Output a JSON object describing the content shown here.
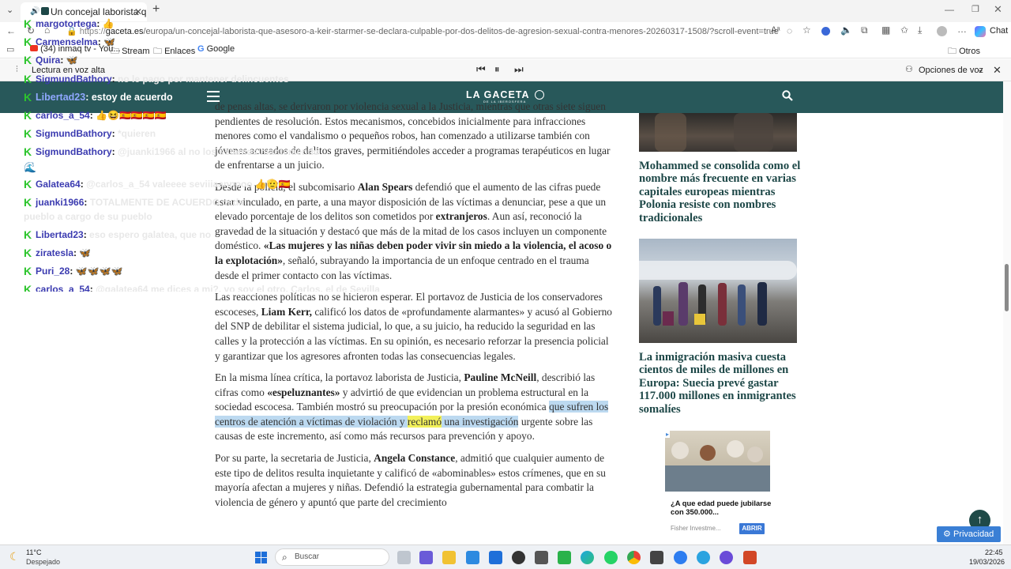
{
  "browser": {
    "tab_title": "Un concejal laborista que ase",
    "url_prefix": "https://",
    "url_domain": "gaceta.es",
    "url_path": "/europa/un-concejal-laborista-que-asesoro-a-keir-starmer-se-declara-culpable-por-dos-delitos-de-agresion-sexual-contra-menores-20260317-1508/?scroll-event=true",
    "chat_label": "Chat",
    "bookmarks": [
      "(34) inmaq tv - You...",
      "Stream",
      "Enlaces",
      "Google"
    ],
    "other_favorites": "Otros favoritos",
    "read_aloud_label": "Lectura en voz alta",
    "voice_options_label": "Opciones de voz"
  },
  "site": {
    "logo_text": "LA GACETA",
    "logo_sub": "DE LA IBEROSFERA"
  },
  "article": {
    "p1_frag": "de penas altas, se derivaron por violencia sexual a la Justicia, mientras que otras siete siguen pendientes de resolución. Estos mecanismos, concebidos inicialmente para infracciones menores como el vandalismo o pequeños robos, han comenzado a utilizarse también con jóvenes acusados de delitos graves, permitiéndoles acceder a programas terapéuticos en lugar de enfrentarse a un juicio.",
    "p2_a": "Desde la policía, el subcomisario ",
    "p2_b": "Alan Spears",
    "p2_c": " defendió que el aumento de las cifras puede estar vinculado, en parte, a una mayor disposición de las víctimas a denunciar, pese a que un elevado porcentaje de los delitos son cometidos por ",
    "p2_d": "extranjeros",
    "p2_e": ". Aun así, reconoció la gravedad de la situación y destacó que más de la mitad de los casos incluyen un componente doméstico. ",
    "p2_f": "«Las mujeres y las niñas deben poder vivir sin miedo a la violencia, el acoso o la explotación»",
    "p2_g": ", señaló, subrayando la importancia de un enfoque centrado en el trauma desde el primer contacto con las víctimas.",
    "p3_a": "Las reacciones políticas no se hicieron esperar. El portavoz de Justicia de los conservadores escoceses, ",
    "p3_b": "Liam Kerr,",
    "p3_c": " calificó los datos de «profundamente alarmantes» y acusó al Gobierno del SNP de debilitar el sistema judicial, lo que, a su juicio, ha reducido la seguridad en las calles y la protección a las víctimas. En su opinión, es necesario reforzar la presencia policial y garantizar que los agresores afronten todas las consecuencias legales.",
    "p4_a": "En la misma línea crítica, la portavoz laborista de Justicia, ",
    "p4_b": "Pauline McNeill",
    "p4_c": ", describió las cifras como ",
    "p4_d": "«espeluznantes»",
    "p4_e": " y advirtió de que evidencian un problema estructural en la sociedad escocesa. También mostró su preocupación por la presión económica ",
    "p4_f": "que sufren los centros de atención a víctimas de violación y ",
    "p4_g": "reclamó",
    "p4_h": " una investigación",
    "p4_i": " urgente sobre las causas de este incremento, así como más recursos para prevención y apoyo.",
    "p5_a": "Por su parte, la secretaria de Justicia, ",
    "p5_b": "Angela Constance",
    "p5_c": ", admitió que cualquier aumento de este tipo de delitos resulta inquietante y calificó de «abominables» estos crímenes, que en su mayoría afectan a mujeres y niñas. Defendió la estrategia gubernamental para combatir la violencia de género y apuntó que parte del crecimiento"
  },
  "sidebar": {
    "story1_title": "Mohammed se consolida como el nombre más frecuente en varias capitales europeas mientras Polonia resiste con nombres tradicionales",
    "story2_title": "La inmigración masiva cuesta cientos de miles de millones en Europa: Suecia prevé gastar 117.000 millones en inmigrantes somalíes",
    "ad_title": "¿A que edad puede jubilarse con 350.000...",
    "ad_sponsor": "Fisher Investme...",
    "ad_button": "ABRIR",
    "privacy_label": "Privacidad"
  },
  "chat": [
    {
      "user": "margotortega",
      "msg": "👍"
    },
    {
      "user": "Carmenselma",
      "msg": "🦋"
    },
    {
      "user": "Quira",
      "msg": "🦋"
    },
    {
      "user": "SigmundBathory",
      "msg": "no le pago por mantener delincuentes"
    },
    {
      "user": "Libertad23",
      "msg": "estoy de acuerdo"
    },
    {
      "user": "carlos_a_54",
      "msg": "👍😆🇪🇸🇪🇸🇪🇸🇪🇸"
    },
    {
      "user": "SigmundBathory",
      "msg": "*quieren"
    },
    {
      "user": "SigmundBathory",
      "msg": "@juanki1966 al no los estamos manteniendo"
    },
    {
      "user": "Galatea64",
      "msg": "@carlos_a_54 valeeee seviiiaannooo 👍🫡🇪🇸"
    },
    {
      "user": "juanki1966",
      "msg": "TOTALMENTE DE ACUERDO cada pueblo a cargo de su pueblo"
    },
    {
      "user": "Libertad23",
      "msg": "eso espero galatea, que no"
    },
    {
      "user": "ziratesla",
      "msg": "🦋"
    },
    {
      "user": "Puri_28",
      "msg": "🦋🦋🦋🦋"
    },
    {
      "user": "carlos_a_54",
      "msg": "@galatea64 me dices a mi?, yo soy el otro, Carlos, el de Sevilla"
    }
  ],
  "taskbar": {
    "temp": "11°C",
    "weather": "Despejado",
    "search_placeholder": "Buscar",
    "time": "22:45",
    "date": "19/03/2026"
  },
  "colors": {
    "header_bg": "#28585a",
    "headline": "#1d4747",
    "chat_user": "#3b3bb0",
    "chat_k": "#2dc52d"
  }
}
